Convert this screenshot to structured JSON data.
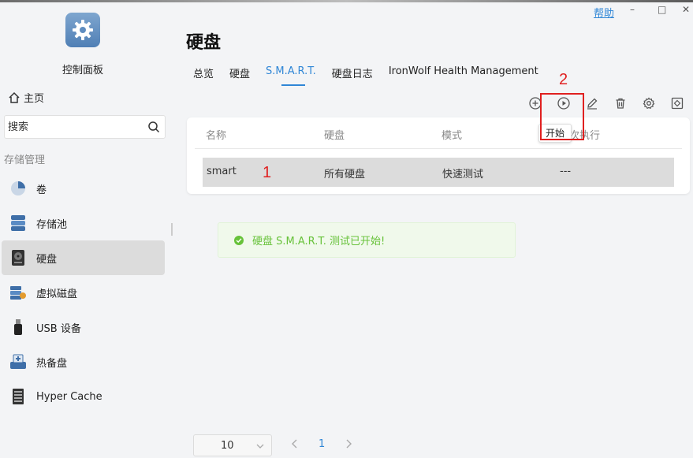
{
  "window": {
    "help_label": "帮助",
    "minimize": "–",
    "maximize": "□",
    "close": "✕"
  },
  "sidebar": {
    "app_title": "控制面板",
    "home_label": "主页",
    "search_placeholder": "搜索",
    "section_label": "存储管理",
    "items": [
      {
        "label": "卷",
        "icon": "pie-icon"
      },
      {
        "label": "存储池",
        "icon": "storage-pool-icon"
      },
      {
        "label": "硬盘",
        "icon": "hard-disk-icon",
        "active": true
      },
      {
        "label": "虚拟磁盘",
        "icon": "virtual-disk-icon"
      },
      {
        "label": "USB 设备",
        "icon": "usb-icon"
      },
      {
        "label": "热备盘",
        "icon": "hot-spare-icon"
      },
      {
        "label": "Hyper Cache",
        "icon": "hyper-cache-icon"
      }
    ]
  },
  "main": {
    "title": "硬盘",
    "tabs": [
      {
        "label": "总览"
      },
      {
        "label": "硬盘"
      },
      {
        "label": "S.M.A.R.T.",
        "active": true
      },
      {
        "label": "硬盘日志"
      },
      {
        "label": "IronWolf Health Management"
      }
    ],
    "toolbar": [
      "add-icon",
      "play-icon",
      "edit-icon",
      "delete-icon",
      "settings-icon",
      "fullscreen-icon"
    ],
    "table": {
      "headers": [
        "名称",
        "硬盘",
        "模式",
        "次执行"
      ],
      "rows": [
        {
          "name": "smart",
          "disk": "所有硬盘",
          "mode": "快速测试",
          "last": "---"
        }
      ]
    },
    "tooltip": "开始",
    "annotations": {
      "one": "1",
      "two": "2"
    },
    "success_message": "硬盘 S.M.A.R.T. 测试已开始!",
    "pagination": {
      "page_size": "10",
      "current_page": "1"
    }
  },
  "colors": {
    "accent": "#2f86d6",
    "success": "#67c23a",
    "annotation": "#e02020"
  }
}
